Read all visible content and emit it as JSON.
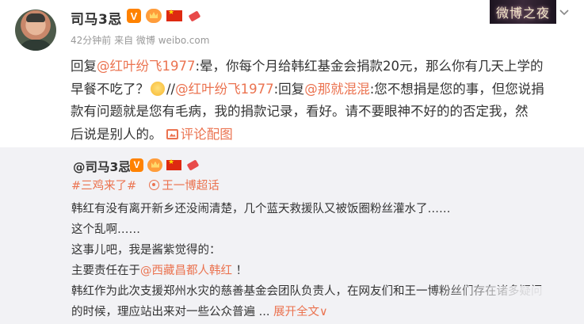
{
  "post": {
    "author": "司马3忌",
    "meta": "42分钟前 来自 微博 weibo.com",
    "text_lines": {
      "p1_prefix": "回复",
      "p1_at": "@红叶纷飞1977",
      "p1_rest": ":晕，你每个月给韩红基金会捐款20元，那么你有几天上学的",
      "p2_a": "早餐不吃了？",
      "p2_b": "//",
      "p2_at": "@红叶纷飞1977",
      "p2_c": ":回复",
      "p2_at2": "@那就混混",
      "p2_d": ":您不想捐是您的事，但您说捐",
      "p3": "款有问题就是您有毛病，我的捐款记录，看好。请不要眼神不好的的否定我，然",
      "p4": "后说是别人的。",
      "p4_link": "评论配图"
    }
  },
  "watermark": "微博之夜",
  "repost": {
    "author": "@司马3忌",
    "topics": [
      "#三鸡来了#",
      "王一博超话"
    ],
    "lines": [
      "韩红有没有离开新乡还没闹清楚，几个蓝天救援队又被饭圈粉丝灌水了……",
      "这个乱啊……",
      "这事儿吧，我是酱紫觉得的：",
      "主要责任在于",
      "@西藏昌都人韩红",
      " ！",
      "韩红作为此次支援郑州水灾的慈善基金会团队负责人，在网友们和王一博粉丝们存在诸多疑问",
      "的时候，理应站出来对一些公众普遍 ...",
      "展开全文",
      "∨"
    ]
  },
  "colors": {
    "accent": "#eb7350",
    "repost_bg": "#f2f2f5",
    "vip": "#ff8200"
  },
  "icons": [
    "avatar",
    "vip-icon",
    "crown-icon",
    "flag-icon",
    "decoration-icon",
    "chevron-down-icon",
    "image-icon",
    "topic-icon",
    "super-topic-icon"
  ]
}
